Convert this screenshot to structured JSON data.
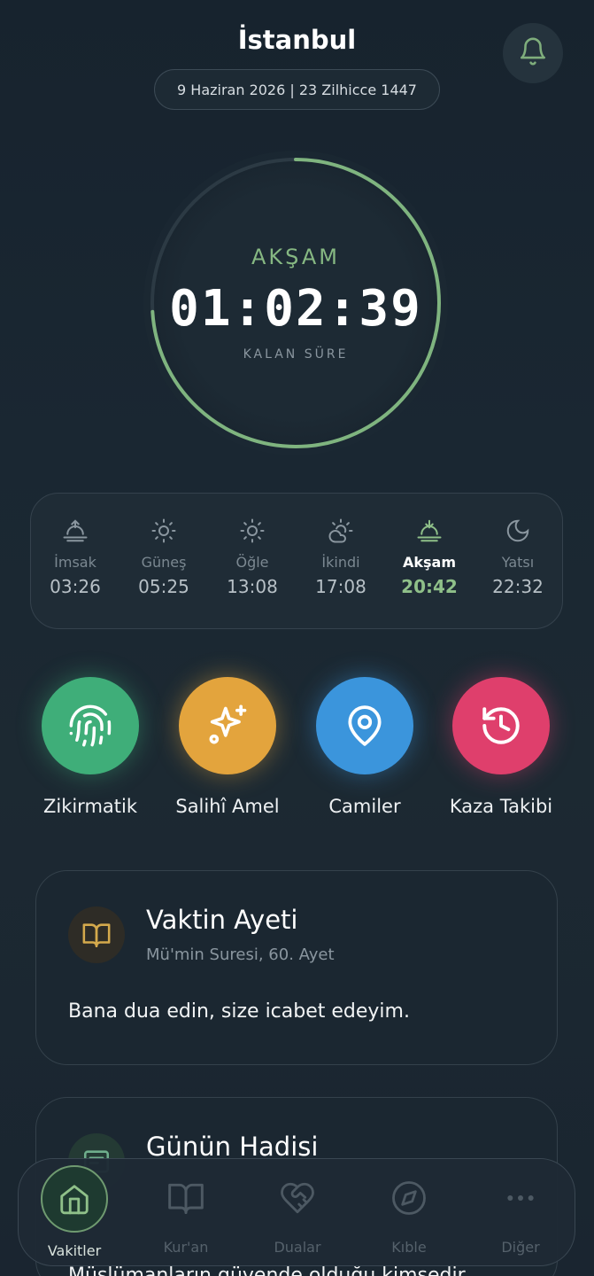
{
  "header": {
    "city": "İstanbul",
    "date": "9 Haziran 2026 | 23 Zilhicce 1447",
    "bell_icon": "bell-icon"
  },
  "timer": {
    "prayer": "AKŞAM",
    "countdown": "01:02:39",
    "caption": "KALAN SÜRE",
    "progress_fraction": 0.74
  },
  "prayer_times": [
    {
      "label": "İmsak",
      "time": "03:26",
      "icon": "sunrise-up-icon"
    },
    {
      "label": "Güneş",
      "time": "05:25",
      "icon": "sun-icon"
    },
    {
      "label": "Öğle",
      "time": "13:08",
      "icon": "sun-icon"
    },
    {
      "label": "İkindi",
      "time": "17:08",
      "icon": "cloud-sun-icon"
    },
    {
      "label": "Akşam",
      "time": "20:42",
      "icon": "sunset-down-icon"
    },
    {
      "label": "Yatsı",
      "time": "22:32",
      "icon": "moon-icon"
    }
  ],
  "quick_actions": [
    {
      "label": "Zikirmatik",
      "icon": "fingerprint-icon",
      "color": "#3fae79"
    },
    {
      "label": "Salihî Amel",
      "icon": "sparkles-icon",
      "color": "#e3a43d"
    },
    {
      "label": "Camiler",
      "icon": "map-pin-icon",
      "color": "#3b95dc"
    },
    {
      "label": "Kaza Takibi",
      "icon": "history-icon",
      "color": "#df3f6c"
    }
  ],
  "verse_card": {
    "title": "Vaktin Ayeti",
    "subtitle": "Mü'min Suresi, 60. Ayet",
    "text": "Bana dua edin, size icabet edeyim.",
    "icon": "book-open-icon"
  },
  "hadith_card": {
    "title": "Günün Hadisi",
    "text": "Müslümanların güvende olduğu kimsedir",
    "icon": "note-icon"
  },
  "nav": [
    {
      "label": "Vakitler",
      "icon": "home-icon"
    },
    {
      "label": "Kur'an",
      "icon": "book-open-icon"
    },
    {
      "label": "Dualar",
      "icon": "heart-handshake-icon"
    },
    {
      "label": "Kıble",
      "icon": "compass-icon"
    },
    {
      "label": "Diğer",
      "icon": "more-dots-icon"
    }
  ],
  "colors": {
    "accent_green": "#8fc089",
    "background": "#1a2732"
  }
}
